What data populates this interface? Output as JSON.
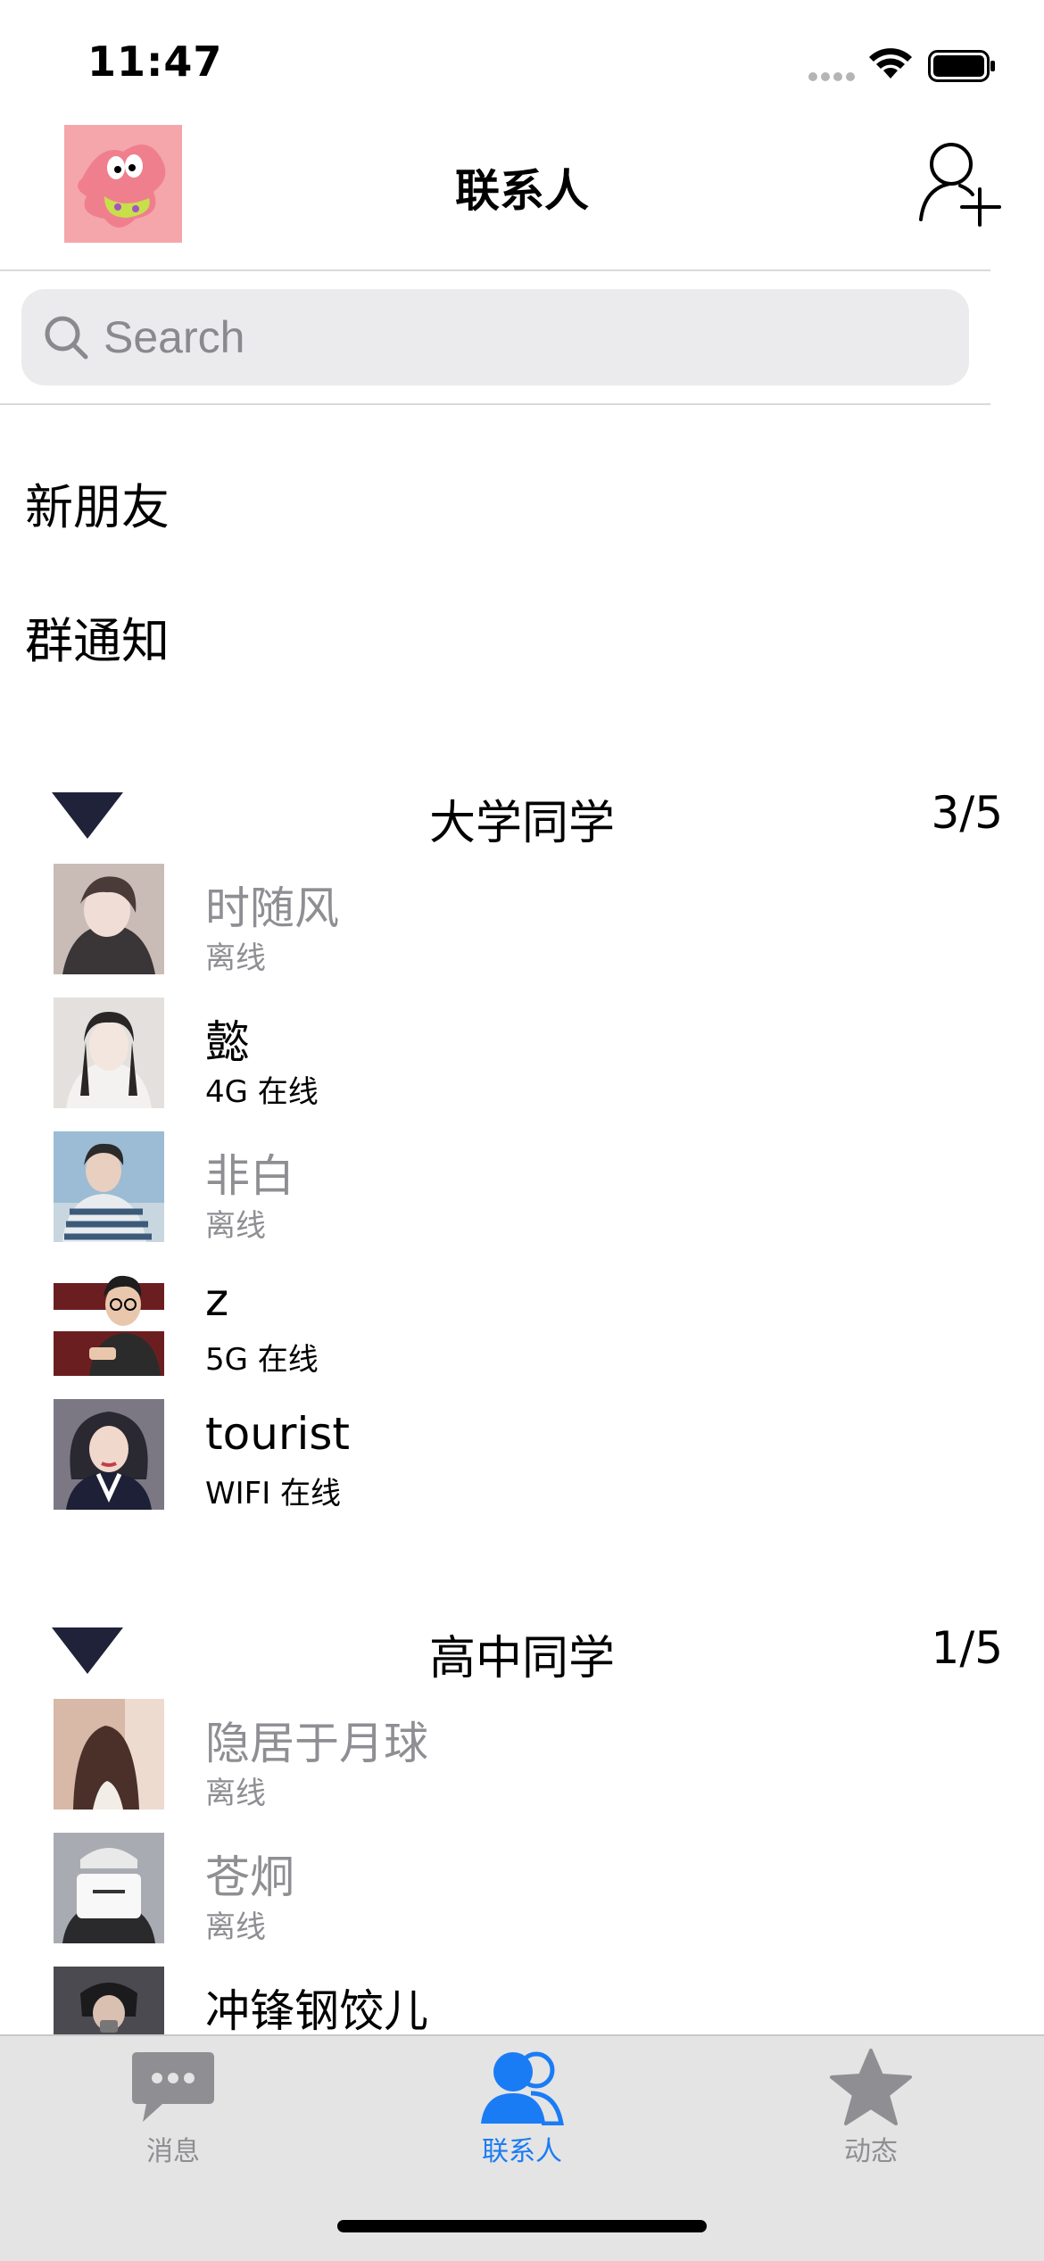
{
  "status_bar": {
    "time": "11:47"
  },
  "nav": {
    "title": "联系人"
  },
  "search": {
    "placeholder": "Search"
  },
  "menu": {
    "new_friends": "新朋友",
    "group_notice": "群通知"
  },
  "groups": [
    {
      "name": "大学同学",
      "count": "3/5",
      "contacts": [
        {
          "name": "时随风",
          "status": "离线",
          "online": false,
          "avatar_color": "#b8a9a3"
        },
        {
          "name": "懿",
          "status": "4G 在线",
          "online": true,
          "avatar_color": "#d7d2cf"
        },
        {
          "name": "非白",
          "status": "离线",
          "online": false,
          "avatar_color": "#7ea3c0"
        },
        {
          "name": "z",
          "status": "5G 在线",
          "online": true,
          "avatar_color": "#7b2b2b"
        },
        {
          "name": "tourist",
          "status": "WIFI 在线",
          "online": true,
          "avatar_color": "#3b3d54"
        }
      ]
    },
    {
      "name": "高中同学",
      "count": "1/5",
      "contacts": [
        {
          "name": "隐居于月球",
          "status": "离线",
          "online": false,
          "avatar_color": "#c79a86"
        },
        {
          "name": "苍炯",
          "status": "离线",
          "online": false,
          "avatar_color": "#8c8f94"
        },
        {
          "name": "冲锋钢饺儿",
          "status": "",
          "online": true,
          "avatar_color": "#3b3b3f"
        }
      ]
    }
  ],
  "tabs": [
    {
      "label": "消息",
      "icon": "chat-bubble-icon",
      "active": false
    },
    {
      "label": "联系人",
      "icon": "contacts-icon",
      "active": true
    },
    {
      "label": "动态",
      "icon": "star-icon",
      "active": false
    }
  ],
  "colors": {
    "accent": "#1a7cf5",
    "offline_text": "#8e8e93",
    "triangle": "#20223a",
    "tab_bar_bg": "#e4e4e4"
  }
}
